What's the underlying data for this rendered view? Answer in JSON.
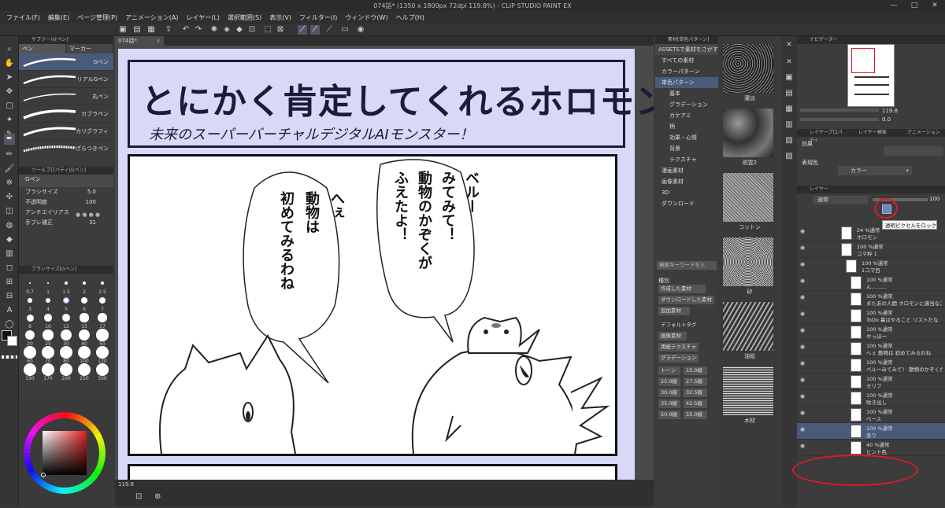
{
  "window": {
    "title": "074話* (1350 x 1800px 72dpi 119.8%) - CLIP STUDIO PAINT EX",
    "controls": [
      "—",
      "□",
      "✕"
    ]
  },
  "menu": [
    "ファイル(F)",
    "編集(E)",
    "ページ管理(P)",
    "アニメーション(A)",
    "レイヤー(L)",
    "選択範囲(S)",
    "表示(V)",
    "フィルター(I)",
    "ウィンドウ(W)",
    "ヘルプ(H)"
  ],
  "subtool": {
    "header": "サブツール[ペン]",
    "tabs": [
      "ペン",
      "マーカー"
    ],
    "brushes": [
      "Gペン",
      "リアルGペン",
      "丸ペン",
      "カブラペン",
      "カリグラフィ",
      "ざらつきペン"
    ]
  },
  "toolprop": {
    "header": "ツールプロパティ[Gペン]",
    "name": "Gペン",
    "rows": [
      {
        "label": "ブラシサイズ",
        "value": "5.0"
      },
      {
        "label": "不透明度",
        "value": "100"
      },
      {
        "label": "アンチエイリアス",
        "value": ""
      },
      {
        "label": "手ブレ補正",
        "value": "31"
      }
    ]
  },
  "brushsize": {
    "header": "ブラシサイズ[Gペン]",
    "sizes": [
      "0.7",
      "1",
      "1.5",
      "2",
      "2.5",
      "3",
      "4",
      "5",
      "6",
      "7",
      "8",
      "10",
      "12",
      "15",
      "17",
      "20",
      "25",
      "30",
      "40",
      "50",
      "60",
      "70",
      "80",
      "100",
      "120",
      "150",
      "170",
      "200",
      "250",
      "300"
    ]
  },
  "canvas": {
    "tab": "074話*",
    "zoom": "119.8",
    "banner_title": "とにかく肯定してくれるホロモン",
    "banner_subtitle": "未来のスーパーバーチャルデジタルAIモンスター！",
    "bubble_left": [
      "へぇ",
      "動物は",
      "初めてみるわね"
    ],
    "bubble_right": [
      "ベルー",
      "みてみて！",
      "動物のかぞくが",
      "ふえたよ！"
    ]
  },
  "materials": {
    "header": "素材[単色パターン]",
    "search_link": "ASSETSで素材をさがす",
    "tree": [
      {
        "label": "すべての素材",
        "level": 1
      },
      {
        "label": "カラーパターン",
        "level": 1
      },
      {
        "label": "単色パターン",
        "level": 1,
        "selected": true
      },
      {
        "label": "基本",
        "level": 2
      },
      {
        "label": "グラデーション",
        "level": 2
      },
      {
        "label": "カケアミ",
        "level": 2
      },
      {
        "label": "柄",
        "level": 2
      },
      {
        "label": "効果・心情",
        "level": 2
      },
      {
        "label": "背景",
        "level": 2
      },
      {
        "label": "テクスチャ",
        "level": 2
      },
      {
        "label": "漫画素材",
        "level": 1
      },
      {
        "label": "画像素材",
        "level": 1
      },
      {
        "label": "3D",
        "level": 1
      },
      {
        "label": "ダウンロード",
        "level": 1
      }
    ],
    "search_placeholder": "検索キーワードを入",
    "tag_header": "種別",
    "tags": [
      "作成した素材",
      "ダウンロードした素材",
      "追加素材",
      "デフォルトタグ",
      "画像素材",
      "用紙テクスチャ",
      "グラデーション",
      "トーン",
      "15.0線",
      "25.0線",
      "27.5線",
      "30.0線",
      "32.5線",
      "35.0線",
      "42.5線",
      "50.0線",
      "55.0線"
    ],
    "thumbs": [
      "濃淡",
      "斑雲2",
      "コットン",
      "砂",
      "油絵",
      "木材"
    ]
  },
  "navigator": {
    "header": "ナビゲーター",
    "zoom": "119.8",
    "angle": "0.0"
  },
  "layerprop": {
    "header": "レイヤープロパティ",
    "header2": "レイヤー検索",
    "header3": "アニメーション",
    "effect": "効果",
    "color_label": "表現色",
    "color_value": "カラー"
  },
  "layers": {
    "header": "レイヤー",
    "blend": "通常",
    "opacity": "100",
    "tooltip": "透明ピクセルをロック",
    "rows": [
      {
        "t1": "24 %通常",
        "t2": "ホロモン",
        "indent": 0
      },
      {
        "t1": "100 %通常",
        "t2": "コマ枠 1",
        "indent": 0
      },
      {
        "t1": "100 %通常",
        "t2": "1コマ目",
        "indent": 1
      },
      {
        "t1": "100 %通常",
        "t2": "ん………",
        "indent": 2
      },
      {
        "t1": "100 %通常",
        "t2": "またあの人間 ホロモンに適当なこと教えて",
        "indent": 2
      },
      {
        "t1": "100 %通常",
        "t2": "ToDo 裏はやること リストだな",
        "indent": 2
      },
      {
        "t1": "100 %通常",
        "t2": "やっほー",
        "indent": 2
      },
      {
        "t1": "100 %通常",
        "t2": "へぇ 動物は 初めてみるわね",
        "indent": 2
      },
      {
        "t1": "100 %通常",
        "t2": "ベルーみてみて！ 動物のかぞくがふえたよ！",
        "indent": 2
      },
      {
        "t1": "100 %通常",
        "t2": "セリフ",
        "indent": 2
      },
      {
        "t1": "100 %通常",
        "t2": "吹き出し",
        "indent": 2
      },
      {
        "t1": "100 %通常",
        "t2": "ベース",
        "indent": 2
      },
      {
        "t1": "100 %通常",
        "t2": "塗り",
        "indent": 2,
        "selected": true
      },
      {
        "t1": "40 %通常",
        "t2": "ヒント色",
        "indent": 2
      }
    ]
  },
  "colors": {
    "accent_red": "#e0182a",
    "selection": "#4a5a7a",
    "paper": "#d8d8f8",
    "ink": "#1b1b3a"
  }
}
